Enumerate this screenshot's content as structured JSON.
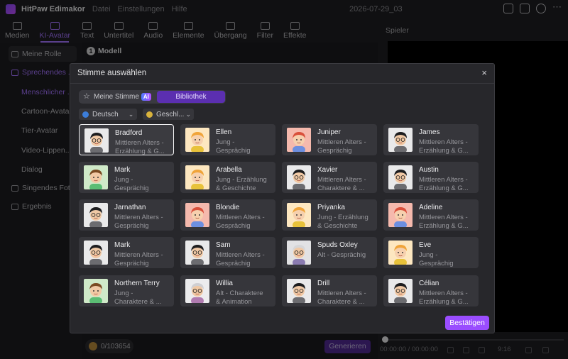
{
  "app": {
    "name": "HitPaw Edimakor",
    "menu": [
      "Datei",
      "Einstellungen",
      "Hilfe"
    ],
    "project_date": "2026-07-29_03"
  },
  "toolbar": {
    "tools": [
      {
        "label": "Medien",
        "icon": "media-icon"
      },
      {
        "label": "KI-Avatar",
        "icon": "avatar-icon",
        "active": true
      },
      {
        "label": "Text",
        "icon": "text-icon"
      },
      {
        "label": "Untertitel",
        "icon": "subtitle-icon"
      },
      {
        "label": "Audio",
        "icon": "audio-icon"
      },
      {
        "label": "Elemente",
        "icon": "elements-icon"
      },
      {
        "label": "Übergang",
        "icon": "transition-icon"
      },
      {
        "label": "Filter",
        "icon": "filter-icon"
      },
      {
        "label": "Effekte",
        "icon": "effects-icon"
      }
    ]
  },
  "sidebar": {
    "items": [
      {
        "label": "Meine Rolle",
        "icon": "role-icon"
      },
      {
        "label": "Sprechendes ...",
        "icon": "talking-icon",
        "active": true
      },
      {
        "label": "Singendes Foto",
        "icon": "singing-icon"
      },
      {
        "label": "Ergebnis",
        "icon": "result-icon"
      }
    ],
    "sub_items": [
      {
        "label": "Menschlicher ...",
        "active": true
      },
      {
        "label": "Cartoon-Avatar"
      },
      {
        "label": "Tier-Avatar"
      },
      {
        "label": "Video-Lippen..."
      },
      {
        "label": "Dialog"
      }
    ]
  },
  "middle": {
    "step_number": "1",
    "step_label": "Modell",
    "credits": "0/103654",
    "generate_label": "Generieren"
  },
  "player": {
    "title": "Spieler",
    "time": "00:00:00 / 00:00:00",
    "duration": "9:16"
  },
  "dialog": {
    "title": "Stimme auswählen",
    "close": "×",
    "tabs": {
      "my_voice": "Meine Stimme",
      "ai_badge": "AI",
      "library": "Bibliothek"
    },
    "filters": [
      {
        "label": "Deutsch",
        "icon": "globe-icon"
      },
      {
        "label": "Geschl...",
        "icon": "gender-icon"
      }
    ],
    "confirm_label": "Bestätigen",
    "voices": [
      {
        "name": "Bradford",
        "desc1": "Mittleren Alters -",
        "desc2": "Erzählung & G...",
        "avatar": "man-glasses",
        "selected": true
      },
      {
        "name": "Ellen",
        "desc1": "Jung -",
        "desc2": "Gesprächig",
        "avatar": "girl-blonde"
      },
      {
        "name": "Juniper",
        "desc1": "Mittleren Alters -",
        "desc2": "Gesprächig",
        "avatar": "woman-red"
      },
      {
        "name": "James",
        "desc1": "Mittleren Alters -",
        "desc2": "Erzählung & G...",
        "avatar": "man-glasses"
      },
      {
        "name": "Mark",
        "desc1": "Jung -",
        "desc2": "Gesprächig",
        "avatar": "boy-brown"
      },
      {
        "name": "Arabella",
        "desc1": "Jung - Erzählung",
        "desc2": "& Geschichte",
        "avatar": "girl-blonde"
      },
      {
        "name": "Xavier",
        "desc1": "Mittleren Alters -",
        "desc2": "Charaktere & ...",
        "avatar": "man-glasses"
      },
      {
        "name": "Austin",
        "desc1": "Mittleren Alters -",
        "desc2": "Erzählung & G...",
        "avatar": "man-glasses"
      },
      {
        "name": "Jarnathan",
        "desc1": "Mittleren Alters -",
        "desc2": "Gesprächig",
        "avatar": "man-glasses"
      },
      {
        "name": "Blondie",
        "desc1": "Mittleren Alters -",
        "desc2": "Gesprächig",
        "avatar": "woman-red"
      },
      {
        "name": "Priyanka",
        "desc1": "Jung - Erzählung",
        "desc2": "& Geschichte",
        "avatar": "girl-blonde"
      },
      {
        "name": "Adeline",
        "desc1": "Mittleren Alters -",
        "desc2": "Erzählung & G...",
        "avatar": "woman-red"
      },
      {
        "name": "Mark",
        "desc1": "Mittleren Alters -",
        "desc2": "Gesprächig",
        "avatar": "man-glasses"
      },
      {
        "name": "Sam",
        "desc1": "Mittleren Alters -",
        "desc2": "Gesprächig",
        "avatar": "man-glasses"
      },
      {
        "name": "Spuds Oxley",
        "desc1": "Alt - Gesprächig",
        "desc2": "",
        "avatar": "old-man"
      },
      {
        "name": "Eve",
        "desc1": "Jung -",
        "desc2": "Gesprächig",
        "avatar": "girl-blonde"
      },
      {
        "name": "Northern Terry",
        "desc1": "Jung -",
        "desc2": "Charaktere & ...",
        "avatar": "boy-brown"
      },
      {
        "name": "Willia",
        "desc1": "Alt - Charaktere",
        "desc2": "& Animation",
        "avatar": "old-woman"
      },
      {
        "name": "Drill",
        "desc1": "Mittleren Alters -",
        "desc2": "Charaktere & ...",
        "avatar": "man-glasses"
      },
      {
        "name": "Célian",
        "desc1": "Mittleren Alters -",
        "desc2": "Erzählung & G...",
        "avatar": "man-glasses"
      }
    ]
  },
  "colors": {
    "accent": "#a473ff",
    "confirm": "#9a4dff",
    "library_tab": "#5b2fb0"
  }
}
